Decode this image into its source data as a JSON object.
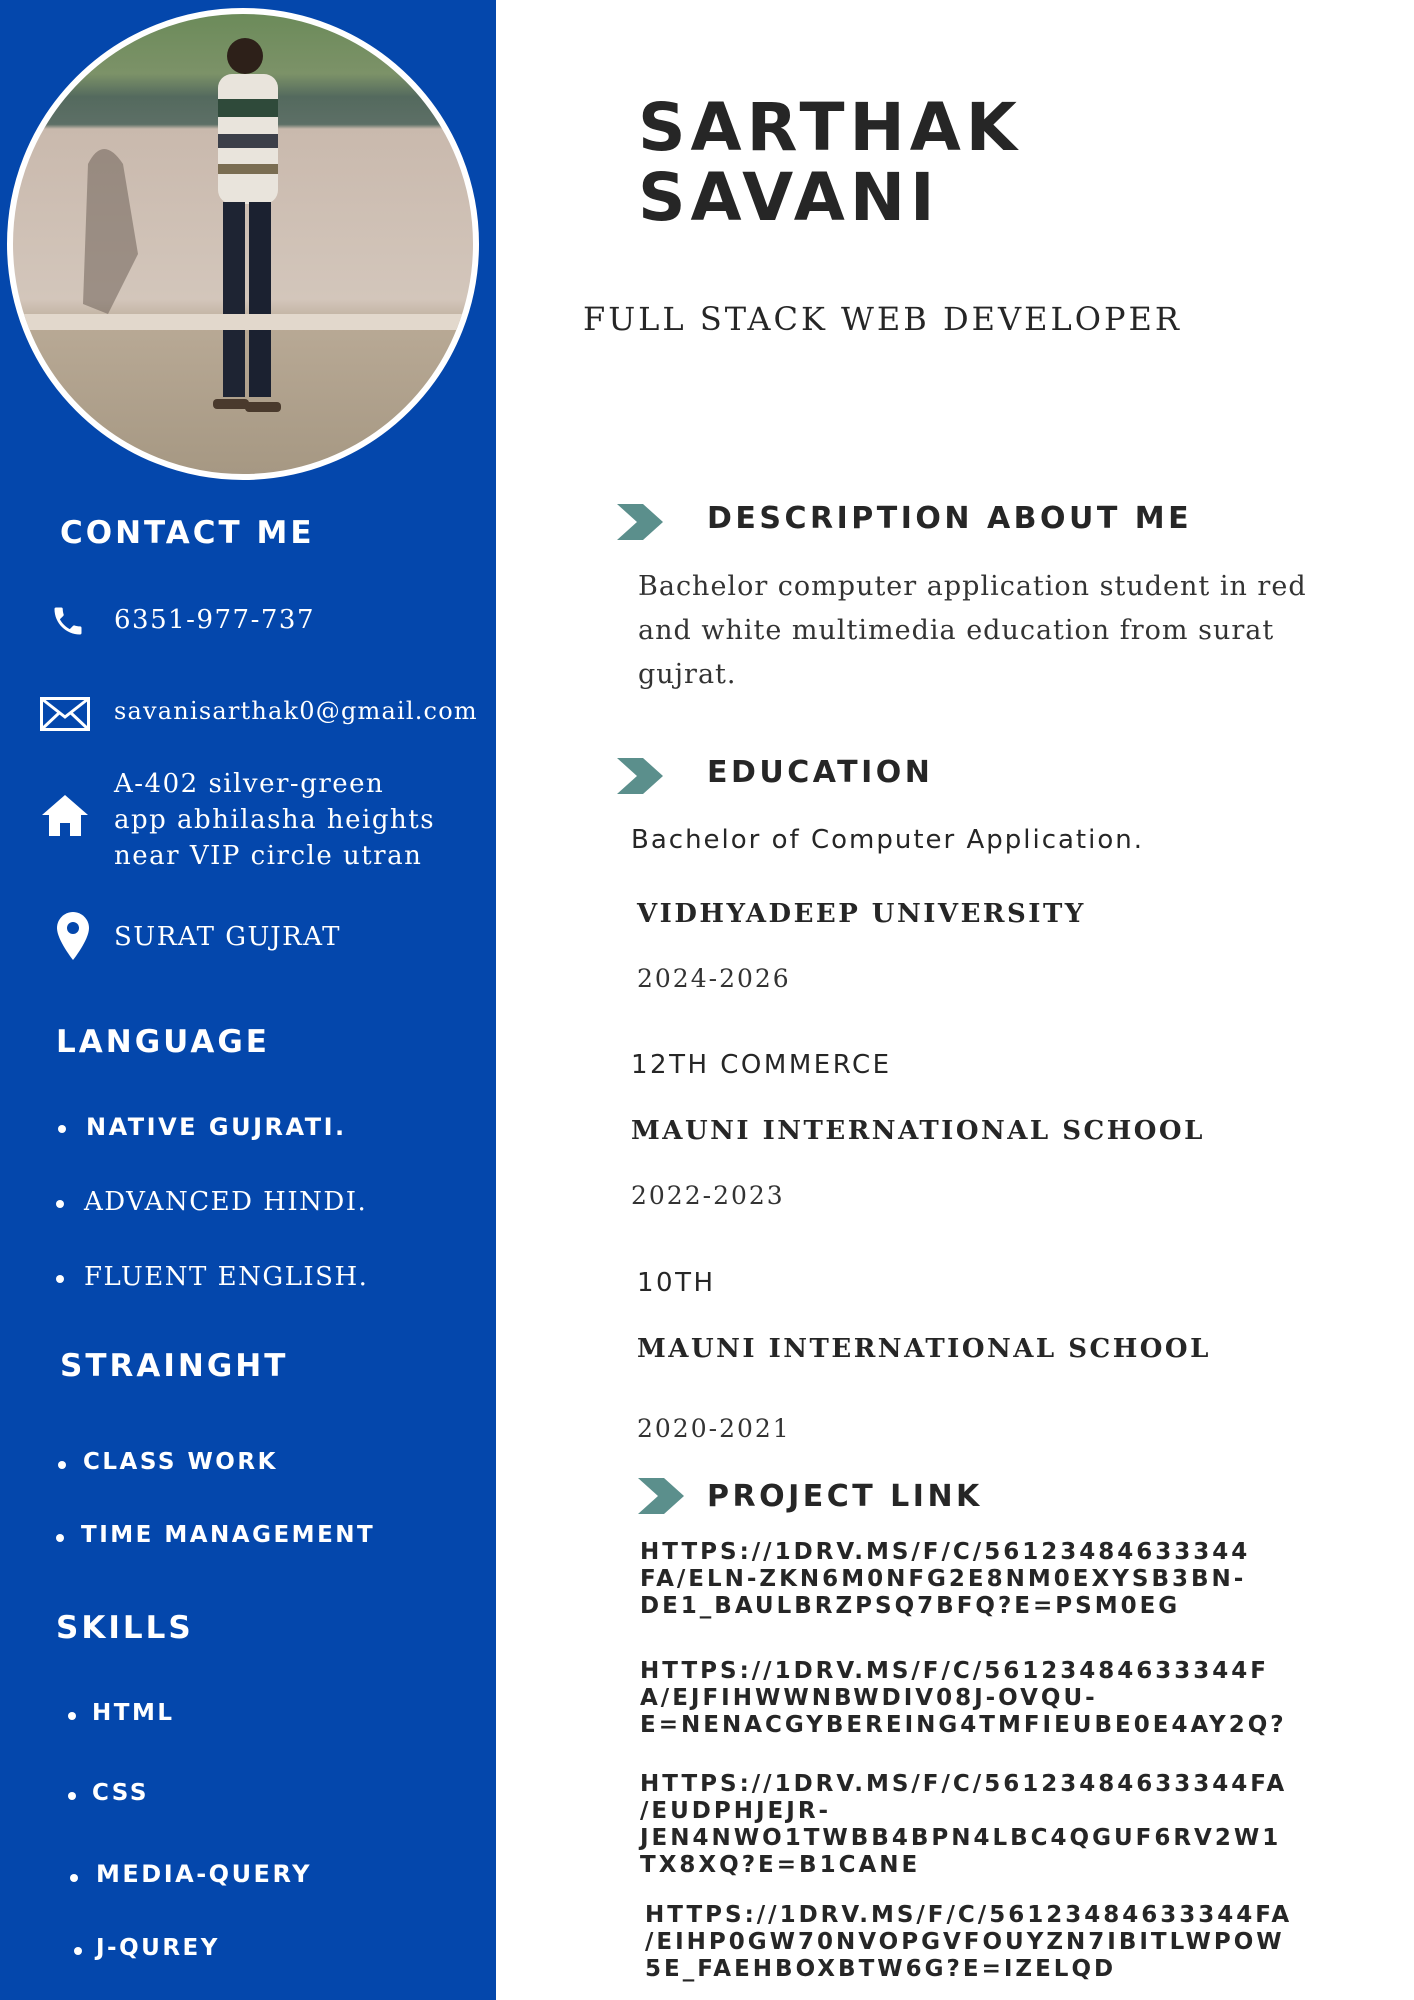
{
  "profile": {
    "first_name": "SARTHAK",
    "last_name": "SAVANI",
    "role": "FULL STACK WEB DEVELOPER"
  },
  "contact": {
    "heading": "CONTACT ME",
    "phone": "6351-977-737",
    "email": "savanisarthak0@gmail.com",
    "address_lines": [
      "A-402 silver-green",
      "app abhilasha heights",
      "near VIP circle utran"
    ],
    "location": "SURAT GUJRAT"
  },
  "language": {
    "heading": "LANGUAGE",
    "items": [
      "NATIVE GUJRATI.",
      "ADVANCED HINDI.",
      "FLUENT ENGLISH."
    ]
  },
  "strength": {
    "heading": "STRAINGHT",
    "items": [
      "CLASS WORK",
      "TIME MANAGEMENT"
    ]
  },
  "skills": {
    "heading": "SKILLS",
    "items": [
      "HTML",
      "CSS",
      "MEDIA-QUERY",
      "J-QUREY"
    ]
  },
  "about": {
    "heading": "DESCRIPTION ABOUT ME",
    "text": "Bachelor computer application student in red and white multimedia education from surat gujrat."
  },
  "education": {
    "heading": "EDUCATION",
    "entries": [
      {
        "degree": "Bachelor of Computer Application.",
        "institution": "VIDHYADEEP UNIVERSITY",
        "years": "2024-2026"
      },
      {
        "degree": "12TH COMMERCE",
        "institution": "MAUNI INTERNATIONAL SCHOOL",
        "years": "2022-2023"
      },
      {
        "degree": "10TH",
        "institution": "MAUNI INTERNATIONAL SCHOOL",
        "years": "2020-2021"
      }
    ]
  },
  "projects": {
    "heading": "PROJECT LINK",
    "links": [
      [
        "HTTPS://1DRV.MS/F/C/56123484633344",
        "FA/ELN-ZKN6M0NFG2E8NM0EXYSB3BN-",
        "DE1_BAULBRZPSQ7BFQ?E=PSM0EG"
      ],
      [
        "HTTPS://1DRV.MS/F/C/56123484633344F",
        "A/EJFIHWWNBWDIV08J-OVQU-",
        "E=NENACGYBEREING4TMFIEUBE0E4AY2Q?"
      ],
      [
        "HTTPS://1DRV.MS/F/C/56123484633344FA",
        "/EUDPHJEJR-",
        "JEN4NWO1TWBB4BPN4LBC4QGUF6RV2W1",
        "TX8XQ?E=B1CANE"
      ],
      [
        "HTTPS://1DRV.MS/F/C/56123484633344FA",
        "/EIHP0GW70NVOPGVFOUYZN7IBITLWPOW",
        "5E_FAEHBOXBTW6G?E=IZELQD"
      ]
    ]
  },
  "colors": {
    "sidebar": "#0447ac",
    "accent_arrow": "#5b8f8c",
    "text_dark": "#262626"
  }
}
